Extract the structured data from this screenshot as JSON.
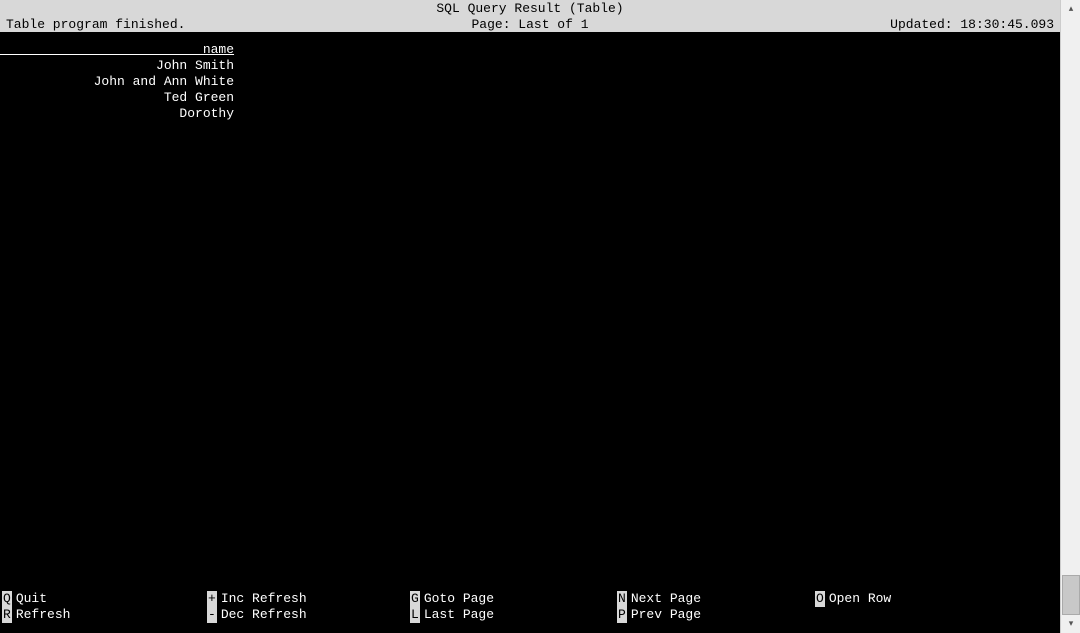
{
  "title": "SQL Query Result (Table)",
  "status": {
    "left": "Table program finished.",
    "center": "Page: Last of 1",
    "right": "Updated: 18:30:45.093"
  },
  "table": {
    "header_line": "                          name",
    "rows": [
      "                    John Smith",
      "            John and Ann White",
      "                     Ted Green",
      "                       Dorothy"
    ]
  },
  "footer": {
    "row1": [
      {
        "key": "Q",
        "label": "Quit"
      },
      {
        "key": "+",
        "label": "Inc Refresh"
      },
      {
        "key": "G",
        "label": "Goto Page"
      },
      {
        "key": "N",
        "label": "Next Page"
      },
      {
        "key": "O",
        "label": "Open Row"
      }
    ],
    "row2": [
      {
        "key": "R",
        "label": "Refresh"
      },
      {
        "key": "-",
        "label": "Dec Refresh"
      },
      {
        "key": "L",
        "label": "Last Page"
      },
      {
        "key": "P",
        "label": "Prev Page"
      }
    ]
  }
}
